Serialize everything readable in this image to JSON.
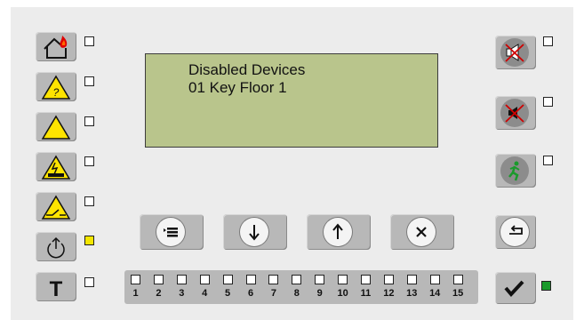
{
  "display": {
    "line1": "Disabled Devices",
    "line2": "01 Key Floor 1"
  },
  "left_buttons": [
    {
      "icon": "fire-house-icon",
      "led": "off"
    },
    {
      "icon": "warning-question-icon",
      "led": "off"
    },
    {
      "icon": "warning-triangle-icon",
      "led": "off"
    },
    {
      "icon": "warning-electrical-icon",
      "led": "off"
    },
    {
      "icon": "warning-switch-icon",
      "led": "off"
    },
    {
      "icon": "power-icon",
      "led": "on",
      "led_color": "#f4e600"
    },
    {
      "icon": "test-t-icon",
      "led": "off",
      "label": "T"
    }
  ],
  "right_buttons": [
    {
      "icon": "sounder-off-icon",
      "led": "off"
    },
    {
      "icon": "buzzer-off-icon",
      "led": "off"
    },
    {
      "icon": "evacuate-icon",
      "led": "off"
    },
    {
      "icon": "back-return-icon"
    },
    {
      "icon": "checkmark-icon",
      "led": "on",
      "led_color": "#1a9a2c"
    }
  ],
  "nav_buttons": [
    {
      "icon": "menu-icon",
      "glyph": "≡"
    },
    {
      "icon": "arrow-down-icon",
      "glyph": "↓"
    },
    {
      "icon": "arrow-up-icon",
      "glyph": "↑"
    },
    {
      "icon": "cancel-x-icon",
      "glyph": "×"
    }
  ],
  "leds": [
    "1",
    "2",
    "3",
    "4",
    "5",
    "6",
    "7",
    "8",
    "9",
    "10",
    "11",
    "12",
    "13",
    "14",
    "15"
  ],
  "colors": {
    "lcd": "#b9c58c",
    "button": "#b8b8b8",
    "panel": "#ececec",
    "warning_yellow": "#ffe400",
    "fire_red": "#e00000"
  }
}
